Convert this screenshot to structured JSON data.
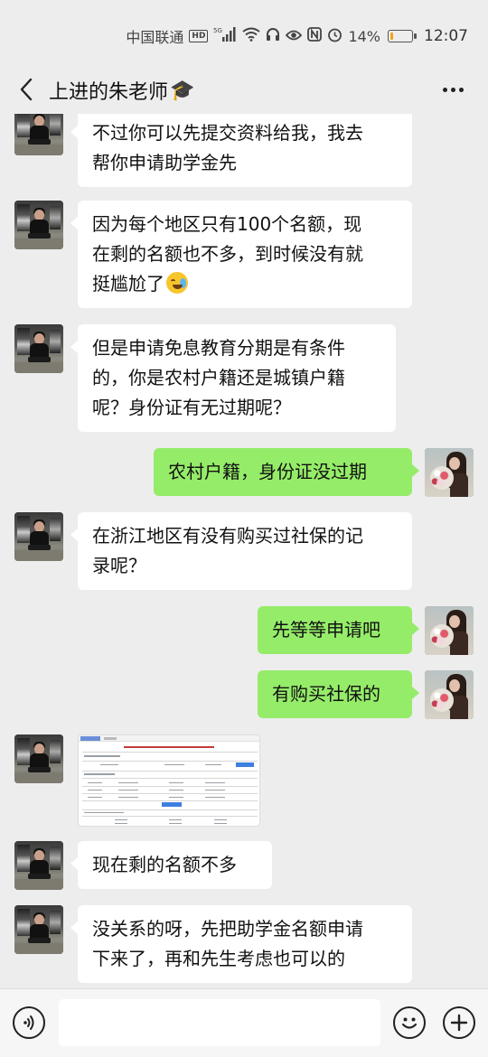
{
  "status_bar": {
    "carrier": "中国联通",
    "hd_label": "HD",
    "network_label": "5G",
    "battery_percent_text": "14%",
    "battery_level": 0.14,
    "time": "12:07",
    "icons": [
      "signal-icon",
      "wifi-icon",
      "headset-icon",
      "eye-icon",
      "nfc-icon",
      "alarm-icon",
      "battery-icon"
    ]
  },
  "header": {
    "title": "上进的朱老师",
    "title_emoji": "🎓",
    "back_icon": "chevron-left-icon",
    "more_icon": "more-dots-icon"
  },
  "messages": [
    {
      "side": "left",
      "type": "text",
      "lines": [
        "不过你可以先提交资料给我，我去",
        "帮你申请助学金先"
      ]
    },
    {
      "side": "left",
      "type": "text",
      "lines": [
        "因为每个地区只有100个名额，现",
        "在剩的名额也不多，到时候没有就",
        "挺尴尬了"
      ],
      "trailing_emoji": "😭"
    },
    {
      "side": "left",
      "type": "text",
      "lines": [
        "但是申请免息教育分期是有条件",
        "的，你是农村户籍还是城镇户籍",
        "呢？身份证有无过期呢？"
      ]
    },
    {
      "side": "right",
      "type": "text",
      "lines": [
        "农村户籍，身份证没过期"
      ]
    },
    {
      "side": "left",
      "type": "text",
      "lines": [
        "在浙江地区有没有购买过社保的记",
        "录呢？"
      ]
    },
    {
      "side": "right",
      "type": "text",
      "lines": [
        "先等等申请吧"
      ]
    },
    {
      "side": "right",
      "type": "text",
      "lines": [
        "有购买社保的"
      ]
    },
    {
      "side": "left",
      "type": "image",
      "description_icon": "screenshot-thumbnail"
    },
    {
      "side": "left",
      "type": "text",
      "lines": [
        "现在剩的名额不多"
      ]
    },
    {
      "side": "left",
      "type": "text",
      "lines": [
        "没关系的呀，先把助学金名额申请",
        "下来了，再和先生考虑也可以的"
      ]
    }
  ],
  "input_bar": {
    "voice_icon": "voice-icon",
    "input_value": "",
    "emoji_icon": "emoji-icon",
    "plus_icon": "plus-icon"
  },
  "colors": {
    "background": "#ededed",
    "bubble_left": "#ffffff",
    "bubble_right": "#95ec69",
    "battery_fill": "#f7a21a"
  }
}
